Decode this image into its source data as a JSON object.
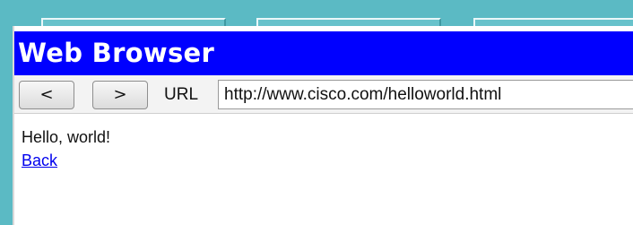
{
  "window": {
    "title": "Web Browser"
  },
  "toolbar": {
    "back_label": "<",
    "forward_label": ">",
    "url_label": "URL",
    "url_value": "http://www.cisco.com/helloworld.html"
  },
  "page": {
    "text": "Hello, world!",
    "link_label": "Back"
  },
  "colors": {
    "title_bar": "#0000ff",
    "frame": "#5bbac4",
    "link": "#0000ee"
  }
}
